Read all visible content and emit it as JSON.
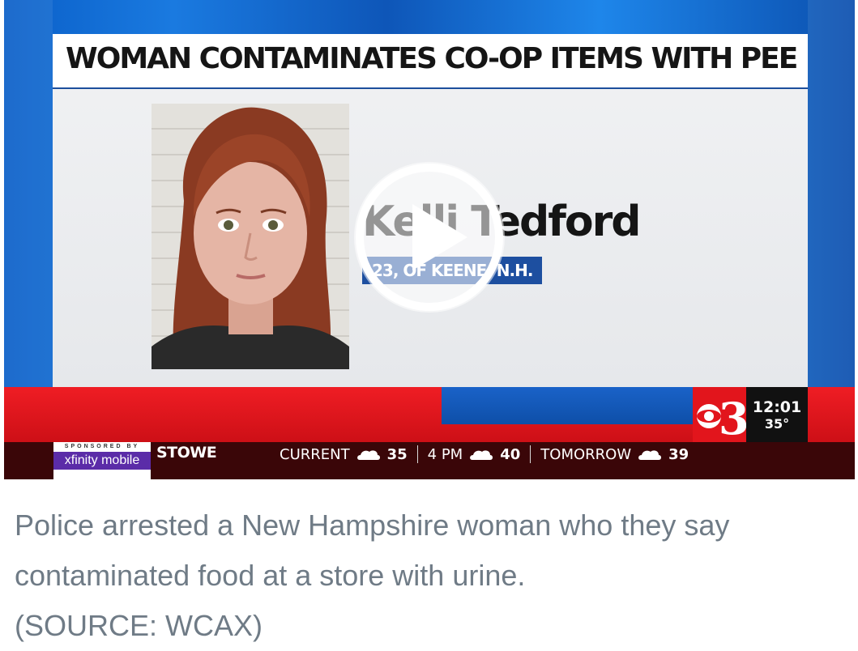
{
  "video": {
    "headline": "WOMAN CONTAMINATES CO-OP ITEMS WITH PEE",
    "person_name": "Kelli Tedford",
    "person_details": "23, OF KEENE, N.H.",
    "play_icon": "play-icon",
    "station_logo": "channel-3-logo",
    "time": "12:01",
    "temperature": "35°",
    "sponsor_small": "SPONSORED BY",
    "sponsor_name": "xfinity mobile",
    "location": "STOWE",
    "weather": [
      {
        "label": "CURRENT",
        "icon": "cloud-icon",
        "value": "35"
      },
      {
        "label": "4 PM",
        "icon": "cloud-icon",
        "value": "40"
      },
      {
        "label": "TOMORROW",
        "icon": "cloud-icon",
        "value": "39"
      }
    ]
  },
  "caption": {
    "text": "Police arrested a New Hampshire woman who they say contaminated food at a store with urine.",
    "source": "(SOURCE: WCAX)"
  },
  "colors": {
    "accent_red": "#e2151c",
    "accent_blue": "#1d4fa0",
    "caption_gray": "#6f7b86"
  }
}
